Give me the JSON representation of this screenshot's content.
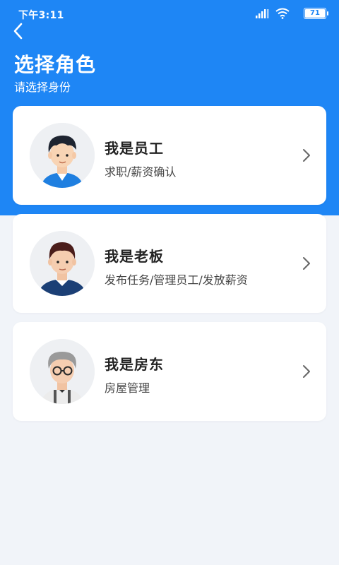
{
  "status_bar": {
    "time": "下午3:11",
    "battery": "71"
  },
  "header": {
    "title": "选择角色",
    "subtitle": "请选择身份",
    "bg_color": "#1e86f5"
  },
  "roles": [
    {
      "name": "我是员工",
      "desc": "求职/薪资确认",
      "avatar": "employee-avatar"
    },
    {
      "name": "我是老板",
      "desc": "发布任务/管理员工/发放薪资",
      "avatar": "boss-avatar"
    },
    {
      "name": "我是房东",
      "desc": "房屋管理",
      "avatar": "landlord-avatar"
    }
  ]
}
